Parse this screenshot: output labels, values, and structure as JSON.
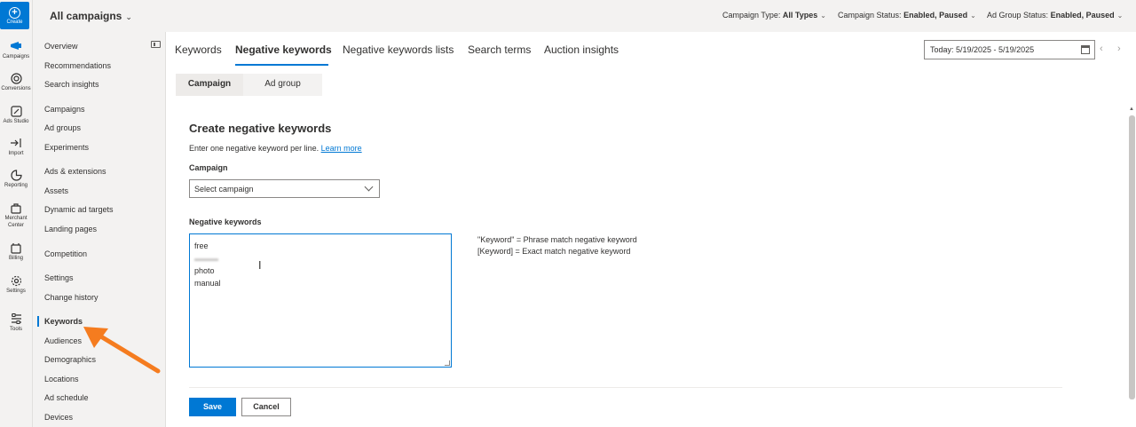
{
  "rail": {
    "create_label": "Create",
    "items": [
      {
        "label": "Campaigns",
        "icon": "campaigns-icon"
      },
      {
        "label": "Conversions",
        "icon": "conversions-icon"
      },
      {
        "label": "Ads Studio",
        "icon": "ads-studio-icon"
      },
      {
        "label": "Import",
        "icon": "import-icon"
      },
      {
        "label": "Reporting",
        "icon": "reporting-icon"
      },
      {
        "label": "Merchant",
        "label2": "Center",
        "icon": "merchant-center-icon"
      },
      {
        "label": "Billing",
        "icon": "billing-icon"
      },
      {
        "label": "Settings",
        "icon": "settings-icon"
      },
      {
        "label": "Tools",
        "icon": "tools-icon"
      }
    ]
  },
  "topbar": {
    "account_title": "All campaigns",
    "filters": [
      {
        "label": "Campaign Type:",
        "value": "All Types"
      },
      {
        "label": "Campaign Status:",
        "value": "Enabled, Paused"
      },
      {
        "label": "Ad Group Status:",
        "value": "Enabled, Paused"
      }
    ]
  },
  "leftnav": {
    "items": [
      "Overview",
      "Recommendations",
      "Search insights",
      "Campaigns",
      "Ad groups",
      "Experiments",
      "Ads & extensions",
      "Assets",
      "Dynamic ad targets",
      "Landing pages",
      "Competition",
      "Settings",
      "Change history",
      "Keywords",
      "Audiences",
      "Demographics",
      "Locations",
      "Ad schedule",
      "Devices"
    ],
    "active": "Keywords"
  },
  "tabs": [
    "Keywords",
    "Negative keywords",
    "Negative keywords lists",
    "Search terms",
    "Auction insights"
  ],
  "active_tab": "Negative keywords",
  "date_range": "Today: 5/19/2025 - 5/19/2025",
  "subtabs": [
    "Campaign",
    "Ad group"
  ],
  "form": {
    "title": "Create negative keywords",
    "help_text": "Enter one negative keyword per line.",
    "learn_more": "Learn more",
    "campaign_label": "Campaign",
    "campaign_placeholder": "Select campaign",
    "negative_keywords_label": "Negative keywords",
    "keywords": [
      "free",
      "",
      "photo",
      "manual"
    ],
    "hints": [
      "\"Keyword\" = Phrase match negative keyword",
      "[Keyword] = Exact match negative keyword"
    ],
    "save_label": "Save",
    "cancel_label": "Cancel"
  },
  "colors": {
    "accent": "#0078d4",
    "annotation_arrow": "#f57c1f"
  }
}
